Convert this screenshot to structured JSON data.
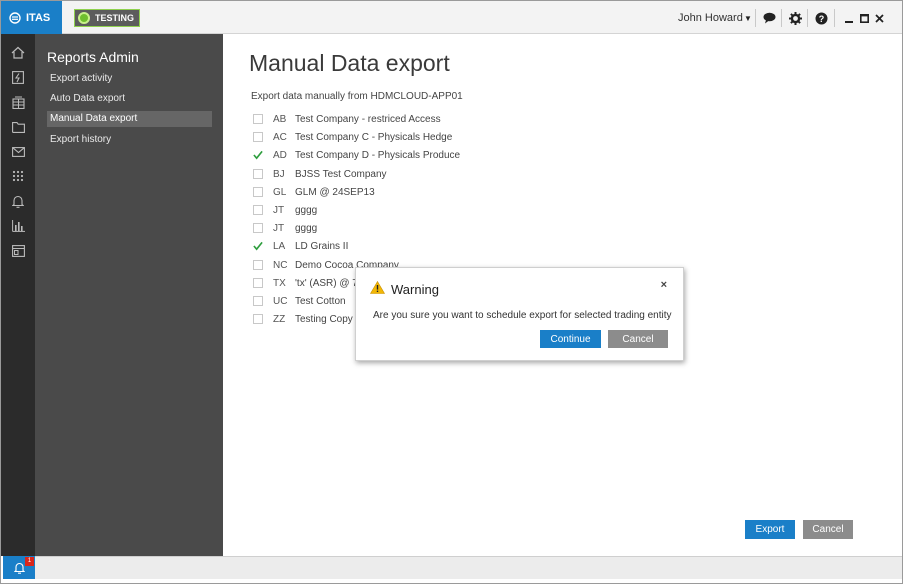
{
  "app": {
    "brand": "ITAS",
    "environment": "TESTING"
  },
  "header": {
    "user_name": "John Howard"
  },
  "sidebar": {
    "title": "Reports Admin",
    "items": [
      {
        "label": "Export activity"
      },
      {
        "label": "Auto Data export"
      },
      {
        "label": "Manual Data export"
      },
      {
        "label": "Export history"
      }
    ],
    "active_item": "Manual Data export"
  },
  "notifications": {
    "badge": "1"
  },
  "main": {
    "title": "Manual Data export",
    "subtitle": "Export data manually from  HDMCLOUD-APP01",
    "entities": [
      {
        "code": "AB",
        "name": "Test Company - restriced Access",
        "checked": false
      },
      {
        "code": "AC",
        "name": "Test Company C - Physicals Hedge",
        "checked": false
      },
      {
        "code": "AD",
        "name": "Test Company D - Physicals Produce",
        "checked": true
      },
      {
        "code": "BJ",
        "name": "BJSS Test Company",
        "checked": false
      },
      {
        "code": "GL",
        "name": "GLM @ 24SEP13",
        "checked": false
      },
      {
        "code": "JT",
        "name": "gggg",
        "checked": false
      },
      {
        "code": "JT",
        "name": "gggg",
        "checked": false
      },
      {
        "code": "LA",
        "name": "LD Grains II",
        "checked": true
      },
      {
        "code": "NC",
        "name": "Demo Cocoa Company",
        "checked": false
      },
      {
        "code": "TX",
        "name": "'tx' (ASR) @ 7j",
        "checked": false
      },
      {
        "code": "UC",
        "name": "Test Cotton",
        "checked": false
      },
      {
        "code": "ZZ",
        "name": "Testing Copy",
        "checked": false
      }
    ],
    "export_label": "Export",
    "cancel_label": "Cancel"
  },
  "dialog": {
    "title": "Warning",
    "close_symbol": "×",
    "message": "Are you sure you want to schedule export for selected trading entity",
    "continue_label": "Continue",
    "cancel_label": "Cancel"
  },
  "colors": {
    "accent": "#1a7fc8",
    "check": "#2e9e3e",
    "sidebar": "#4a4a4a",
    "rail": "#2b2b2b",
    "env_green": "#8fd14f"
  }
}
